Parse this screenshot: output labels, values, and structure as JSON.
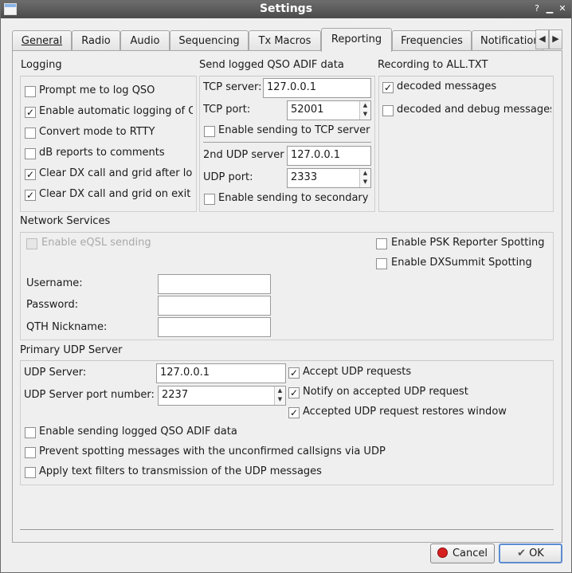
{
  "window": {
    "title": "Settings"
  },
  "tabs": [
    {
      "label": "General"
    },
    {
      "label": "Radio"
    },
    {
      "label": "Audio"
    },
    {
      "label": "Sequencing"
    },
    {
      "label": "Tx Macros"
    },
    {
      "label": "Reporting",
      "active": true
    },
    {
      "label": "Frequencies"
    },
    {
      "label": "Notification"
    }
  ],
  "logging": {
    "title": "Logging",
    "items": [
      {
        "label": "Prompt me to log QSO",
        "checked": false
      },
      {
        "label": "Enable automatic logging of QSO",
        "checked": true
      },
      {
        "label": "Convert mode to RTTY",
        "checked": false
      },
      {
        "label": "dB reports to comments",
        "checked": false
      },
      {
        "label": "Clear DX call and grid after logging",
        "checked": true
      },
      {
        "label": "Clear DX call and grid on exit",
        "checked": true
      }
    ]
  },
  "adif": {
    "title": "Send logged QSO ADIF data",
    "tcp_server_label": "TCP server:",
    "tcp_server_value": "127.0.0.1",
    "tcp_port_label": "TCP port:",
    "tcp_port_value": "52001",
    "tcp_enable_label": "Enable sending to TCP server",
    "udp2_server_label": "2nd UDP server",
    "udp2_server_value": "127.0.0.1",
    "udp2_port_label": "UDP port:",
    "udp2_port_value": "2333",
    "udp2_enable_label": "Enable sending to secondary"
  },
  "alltxt": {
    "title": "Recording to ALL.TXT",
    "decoded_label": "decoded messages",
    "decoded_checked": true,
    "debug_label": "decoded and debug messages",
    "debug_checked": false
  },
  "network": {
    "title": "Network Services",
    "eqsl_label": "Enable eQSL sending",
    "psk_label": "Enable PSK Reporter Spotting",
    "dxsummit_label": "Enable DXSummit Spotting",
    "username_label": "Username:",
    "username_value": "",
    "password_label": "Password:",
    "password_value": "",
    "qth_label": "QTH Nickname:",
    "qth_value": ""
  },
  "udp": {
    "title": "Primary UDP Server",
    "server_label": "UDP Server:",
    "server_value": "127.0.0.1",
    "port_label": "UDP Server port number:",
    "port_value": "2237",
    "accept_label": "Accept UDP requests",
    "notify_label": "Notify on accepted UDP request",
    "restore_label": "Accepted UDP request restores window",
    "send_adif_label": "Enable sending logged QSO ADIF data",
    "prevent_label": "Prevent spotting messages with the unconfirmed callsigns via UDP",
    "filters_label": "Apply text filters to transmission of the UDP messages"
  },
  "buttons": {
    "cancel": "Cancel",
    "ok": "OK"
  },
  "check_glyph": "✓",
  "colors": {
    "titlebar": "#555555",
    "cancel_icon": "#d62020",
    "default_border": "#5b8cd1"
  }
}
